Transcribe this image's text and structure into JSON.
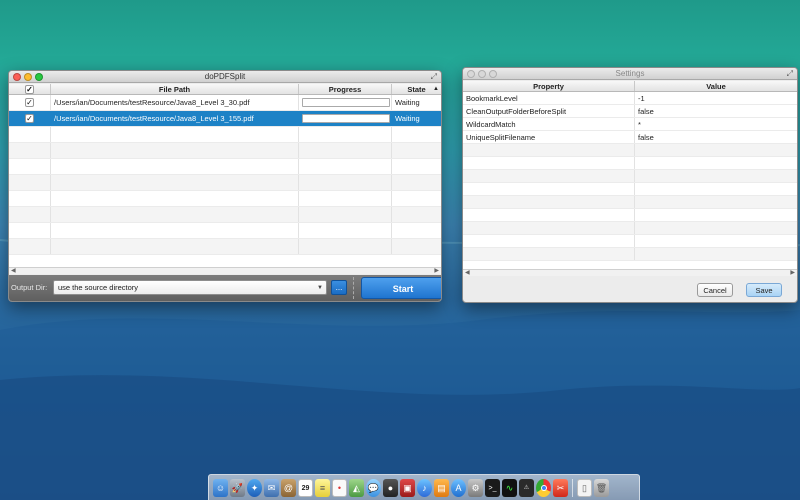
{
  "main_window": {
    "title": "doPDFSplit",
    "columns": {
      "check": "✓",
      "file_path": "File Path",
      "progress": "Progress",
      "state": "State"
    },
    "rows": [
      {
        "checked": "✓",
        "file_path": "/Users/ian/Documents/testResource/Java8_Level 3_30.pdf",
        "progress": 0,
        "state": "Waiting",
        "selected": false
      },
      {
        "checked": "✓",
        "file_path": "/Users/ian/Documents/testResource/Java8_Level 3_155.pdf",
        "progress": 0,
        "state": "Waiting",
        "selected": true
      }
    ],
    "output_dir_label": "Output Dir:",
    "output_dir_value": "use the source directory",
    "browse_label": "...",
    "start_label": "Start"
  },
  "settings_window": {
    "title": "Settings",
    "columns": {
      "property": "Property",
      "value": "Value"
    },
    "rows": [
      {
        "property": "BookmarkLevel",
        "value": "-1"
      },
      {
        "property": "CleanOutputFolderBeforeSplit",
        "value": "false"
      },
      {
        "property": "WildcardMatch",
        "value": "*"
      },
      {
        "property": "UniqueSplitFilename",
        "value": "false"
      }
    ],
    "cancel_label": "Cancel",
    "save_label": "Save"
  },
  "dock": {
    "items": [
      "finder-icon",
      "launchpad-icon",
      "safari-icon",
      "mail-icon",
      "contacts-icon",
      "calendar-icon",
      "notes-icon",
      "reminders-icon",
      "maps-icon",
      "messages-icon",
      "facetime-icon",
      "photo-booth-icon",
      "itunes-icon",
      "ibooks-icon",
      "app-store-icon",
      "system-preferences-icon",
      "terminal-icon",
      "activity-monitor-icon",
      "console-icon",
      "chrome-icon",
      "pdf-app-icon",
      "document-icon",
      "trash-icon"
    ],
    "calendar_day": "29"
  },
  "colors": {
    "selection": "#1d82c6",
    "start_button": "#2f86db",
    "bottom_bar": "#6e6e6e"
  }
}
